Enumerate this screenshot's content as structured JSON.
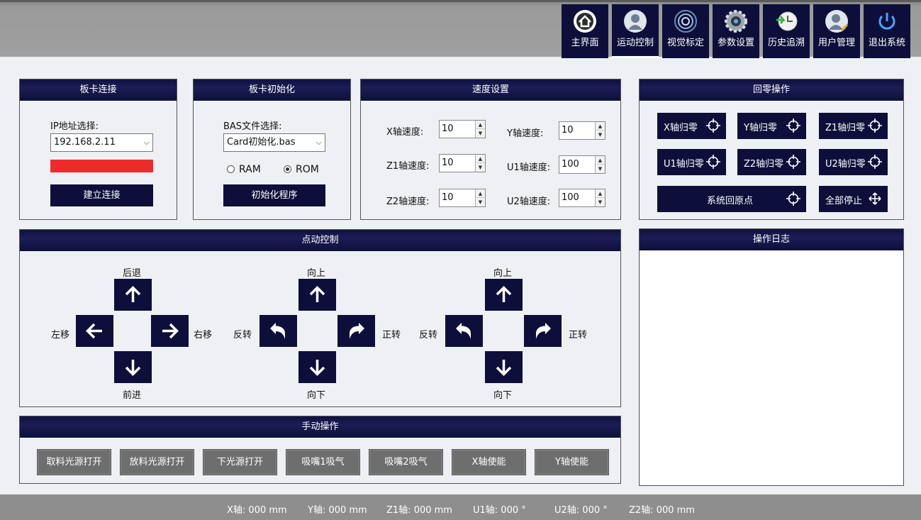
{
  "nav": [
    {
      "label": "主界面",
      "icon": "home-icon"
    },
    {
      "label": "运动控制",
      "icon": "user-icon"
    },
    {
      "label": "视觉标定",
      "icon": "target-icon"
    },
    {
      "label": "参数设置",
      "icon": "gear-icon"
    },
    {
      "label": "历史追溯",
      "icon": "history-icon"
    },
    {
      "label": "用户管理",
      "icon": "user-manage-icon"
    },
    {
      "label": "退出系统",
      "icon": "power-icon"
    }
  ],
  "card_connect": {
    "title": "板卡连接",
    "ip_label": "IP地址选择:",
    "ip_value": "192.168.2.11",
    "status_color": "#ee2b2b",
    "connect_button": "建立连接"
  },
  "card_init": {
    "title": "板卡初始化",
    "bas_label": "BAS文件选择:",
    "bas_value": "Card初始化.bas",
    "radio_ram": "RAM",
    "radio_rom": "ROM",
    "selected": "ROM",
    "init_button": "初始化程序"
  },
  "speed": {
    "title": "速度设置",
    "x_label": "X轴速度:",
    "x_value": "10",
    "y_label": "Y轴速度:",
    "y_value": "10",
    "z1_label": "Z1轴速度:",
    "z1_value": "10",
    "u1_label": "U1轴速度:",
    "u1_value": "100",
    "z2_label": "Z2轴速度:",
    "z2_value": "10",
    "u2_label": "U2轴速度:",
    "u2_value": "100"
  },
  "homing": {
    "title": "回零操作",
    "x": "X轴归零",
    "y": "Y轴归零",
    "z1": "Z1轴归零",
    "u1": "U1轴归零",
    "z2": "Z2轴归零",
    "u2": "U2轴归零",
    "origin": "系统回原点",
    "stop_all": "全部停止"
  },
  "jog": {
    "title": "点动控制",
    "back": "后退",
    "left": "左移",
    "right": "右移",
    "forward": "前进",
    "g2_up": "向上",
    "g2_ccw": "反转",
    "g2_cw": "正转",
    "g2_down": "向下",
    "g3_up": "向上",
    "g3_ccw": "反转",
    "g3_cw": "正转",
    "g3_down": "向下"
  },
  "log": {
    "title": "操作日志"
  },
  "manual": {
    "title": "手动操作",
    "buttons": [
      "取料光源打开",
      "放料光源打开",
      "下光源打开",
      "吸嘴1吸气",
      "吸嘴2吸气",
      "X轴使能",
      "Y轴使能"
    ]
  },
  "status": {
    "x": "X轴: 000 mm",
    "y": "Y轴: 000 mm",
    "z1": "Z1轴: 000 mm",
    "u1": "U1轴: 000 °",
    "u2": "U2轴: 000 °",
    "z2": "Z2轴: 000 mm"
  },
  "colors": {
    "accent": "#0d0f3a",
    "status_red": "#ee2b2b"
  }
}
